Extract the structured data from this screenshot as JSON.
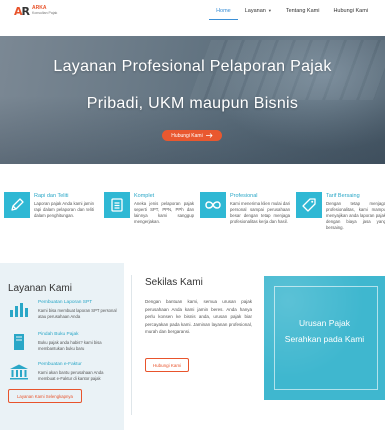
{
  "brand": {
    "mark_left": "A",
    "mark_right": "R",
    "line1": "ARKA",
    "line2": "Konsultan Pajak"
  },
  "nav": {
    "items": [
      {
        "label": "Home",
        "active": true
      },
      {
        "label": "Layanan",
        "dropdown": true
      },
      {
        "label": "Tentang Kami"
      },
      {
        "label": "Hubungi Kami"
      }
    ]
  },
  "hero": {
    "line1": "Layanan Profesional Pelaporan Pajak",
    "line2": "Pribadi, UKM maupun Bisnis",
    "cta": "Hubungi Kami"
  },
  "features": [
    {
      "icon": "pencil-icon",
      "title": "Rapi dan Teliti",
      "desc": "Laporan pajak Anda kami jamin rapi dalam pelaporan dan teliti dalam penghitungan."
    },
    {
      "icon": "document-icon",
      "title": "Komplet",
      "desc": "Aneka jenis pelaporan pajak seperti SPT, PPN, PPh dan lainnya kami sanggup mengerjakan."
    },
    {
      "icon": "infinity-icon",
      "title": "Profesional",
      "desc": "Kami menerima klien mulai dari personal sampai perusahaan besar dengan tetap menjaga profesionalitas kerja dan hasil."
    },
    {
      "icon": "tag-icon",
      "title": "Tarif Bersaing",
      "desc": "Dengan tetap menjaga profesionalitas, kami mampu menyajikan anda laporan pajak dengan biaya jasa yang bersaing."
    }
  ],
  "layanan": {
    "title": "Layanan Kami",
    "items": [
      {
        "icon": "bar-chart-icon",
        "title": "Pembuatan Laporan SPT",
        "desc": "Kami bisa membuat laporan SPT personal atau perusahaan Anda"
      },
      {
        "icon": "book-icon",
        "title": "Pindah Buku Pajak",
        "desc": "Buku pajak anda habis? kami bisa membantukan buku baru"
      },
      {
        "icon": "bank-icon",
        "title": "Pembuatan e-Faktur",
        "desc": "Kami akan bantu perusahaan Anda membuat e-Faktur di kantor pajak"
      }
    ],
    "button": "Layanan Kami Selengkapnya"
  },
  "sekilas": {
    "title": "Sekilas Kami",
    "p1": "Dengan bantuan kami, semua urusan pajak perusahaan Anda kami jamin beres. Anda hanya perlu konsen ke bisnis anda, urusan pajak biar percayakan pada kami. Jaminan layanan profesional, murah dan bergaransi.",
    "button": "Hubungi Kami"
  },
  "urusan": {
    "line1": "Urusan Pajak",
    "line2": "Serahkan pada Kami"
  },
  "colors": {
    "accent": "#e8542c",
    "primary": "#2fb8d4",
    "link": "#3a8fd6"
  }
}
